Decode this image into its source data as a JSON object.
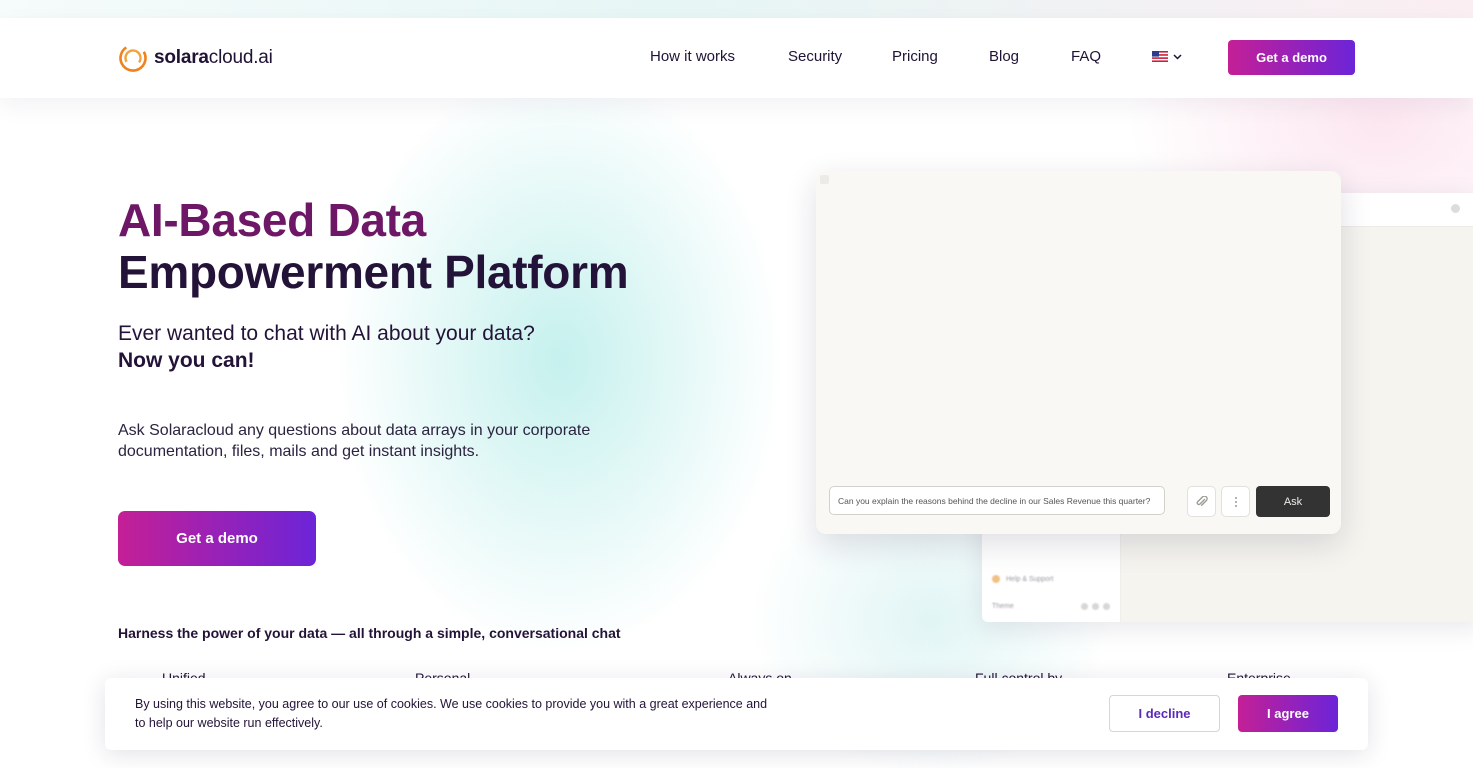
{
  "brand": {
    "logo_bold": "solara",
    "logo_rest": "cloud.ai",
    "accent_magenta": "#c41f96",
    "accent_violet": "#6c24d8",
    "title_magenta": "#6e1766"
  },
  "nav": {
    "links": [
      "How it works",
      "Security",
      "Pricing",
      "Blog",
      "FAQ"
    ],
    "language_icon": "us-flag-icon",
    "demo_label": "Get a demo"
  },
  "hero": {
    "title_line1": "AI-Based Data",
    "title_line2": "Empowerment Platform",
    "subtitle": "Ever wanted to chat with AI about your data?",
    "subtitle_bold": "Now you can!",
    "description": "Ask Solaracloud any questions about data arrays in your corporate documentation, files, mails and get instant insights.",
    "demo_label": "Get a demo",
    "tagline": "Harness the power of your data — all through a simple, conversational chat"
  },
  "features": [
    "Unified",
    "Personal",
    "Always on",
    "Full control by",
    "Enterprise"
  ],
  "mockup": {
    "chat_placeholder": "Can you explain the reasons behind the decline in our Sales Revenue this quarter?",
    "ask_label": "Ask",
    "attach_icon": "paperclip-icon",
    "more_icon": "kebab-menu-icon",
    "sidebar_item": "Help & Support",
    "sidebar_footer": "Theme"
  },
  "cookie": {
    "text": "By using this website, you agree to our use of cookies. We use cookies to provide you with a great experience and to help our website run effectively.",
    "decline_label": "I decline",
    "agree_label": "I agree"
  }
}
